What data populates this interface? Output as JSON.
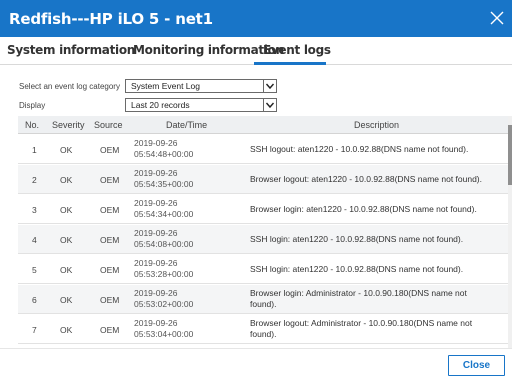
{
  "window": {
    "title": "Redfish---HP iLO 5 - net1"
  },
  "tabs": [
    {
      "label": "System information"
    },
    {
      "label": "Monitoring information"
    },
    {
      "label": "Event logs"
    }
  ],
  "filters": {
    "category_label": "Select an event log category",
    "category_value": "System Event Log",
    "display_label": "Display",
    "display_value": "Last 20 records"
  },
  "table": {
    "headers": [
      "No.",
      "Severity",
      "Source",
      "Date/Time",
      "Description"
    ],
    "rows": [
      {
        "no": "1",
        "severity": "OK",
        "source": "OEM",
        "date": "2019-09-26",
        "time": "05:54:48+00:00",
        "desc1": "SSH logout: aten1220 - 10.0.92.88(DNS name not found).",
        "desc2": ""
      },
      {
        "no": "2",
        "severity": "OK",
        "source": "OEM",
        "date": "2019-09-26",
        "time": "05:54:35+00:00",
        "desc1": "Browser logout: aten1220 - 10.0.92.88(DNS name not found).",
        "desc2": ""
      },
      {
        "no": "3",
        "severity": "OK",
        "source": "OEM",
        "date": "2019-09-26",
        "time": "05:54:34+00:00",
        "desc1": "Browser login: aten1220 - 10.0.92.88(DNS name not found).",
        "desc2": ""
      },
      {
        "no": "4",
        "severity": "OK",
        "source": "OEM",
        "date": "2019-09-26",
        "time": "05:54:08+00:00",
        "desc1": "SSH login: aten1220 - 10.0.92.88(DNS name not found).",
        "desc2": ""
      },
      {
        "no": "5",
        "severity": "OK",
        "source": "OEM",
        "date": "2019-09-26",
        "time": "05:53:28+00:00",
        "desc1": "SSH login: aten1220 - 10.0.92.88(DNS name not found).",
        "desc2": ""
      },
      {
        "no": "6",
        "severity": "OK",
        "source": "OEM",
        "date": "2019-09-26",
        "time": "05:53:02+00:00",
        "desc1": "Browser login: Administrator - 10.0.90.180(DNS name not",
        "desc2": "found)."
      },
      {
        "no": "7",
        "severity": "OK",
        "source": "OEM",
        "date": "2019-09-26",
        "time": "05:53:04+00:00",
        "desc1": "Browser logout: Administrator - 10.0.90.180(DNS name not",
        "desc2": "found)."
      }
    ]
  },
  "footer": {
    "close_label": "Close"
  },
  "colors": {
    "accent": "#1875c8",
    "title_text": "#ffffff"
  }
}
